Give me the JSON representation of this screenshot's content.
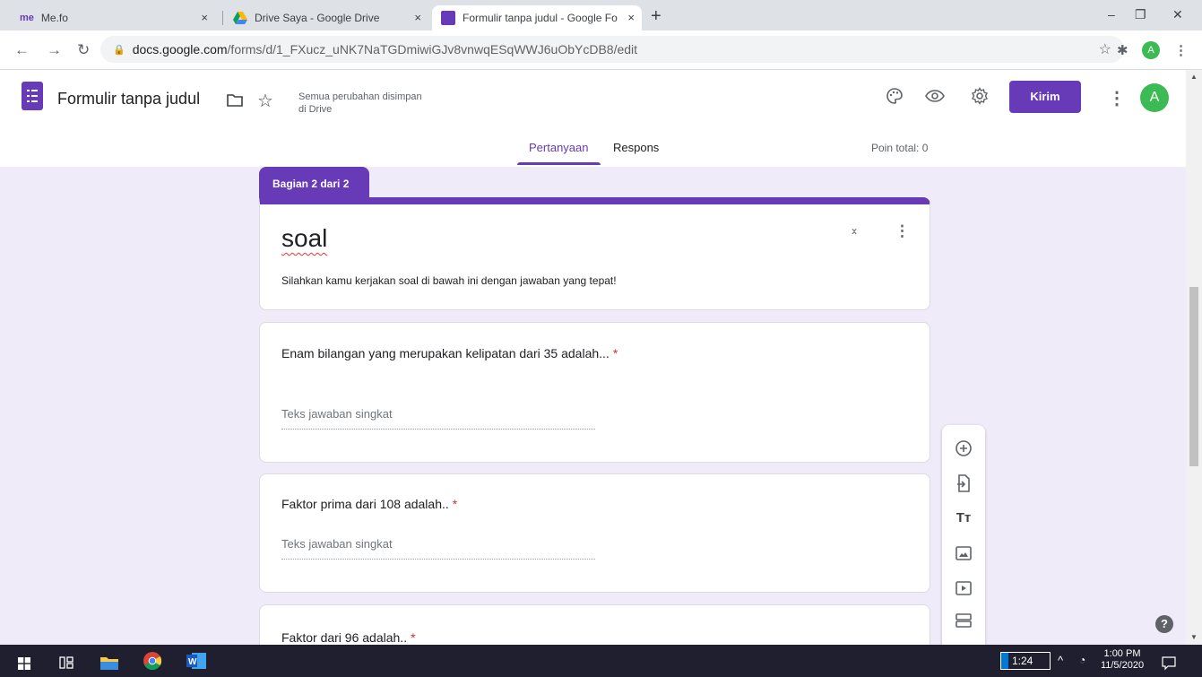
{
  "browser": {
    "tabs": [
      {
        "favicon_text": "me",
        "title": "Me.fo",
        "close": "×"
      },
      {
        "title": "Drive Saya - Google Drive",
        "close": "×"
      },
      {
        "title": "Formulir tanpa judul - Google Fo",
        "close": "×",
        "active": true
      }
    ],
    "new_tab": "+",
    "window_controls": {
      "minimize": "–",
      "restore": "❐",
      "close": "✕"
    },
    "url_domain": "docs.google.com",
    "url_path": "/forms/d/1_FXucz_uNK7NaTGDmiwiGJv8vnwqESqWWJ6uObYcDB8/edit",
    "profile_initial": "A"
  },
  "header": {
    "title": "Formulir tanpa judul",
    "save_status_line1": "Semua perubahan disimpan",
    "save_status_line2": "di Drive",
    "send_label": "Kirim",
    "avatar_initial": "A",
    "tabs": [
      "Pertanyaan",
      "Respons"
    ],
    "active_tab": "Pertanyaan",
    "points": "Poin total: 0"
  },
  "section": {
    "tag": "Bagian 2 dari 2",
    "title": "soal",
    "description": "Silahkan kamu kerjakan soal di bawah ini dengan jawaban yang tepat!"
  },
  "questions": [
    {
      "text": "Enam bilangan yang merupakan kelipatan dari 35 adalah...",
      "required": "*",
      "placeholder": "Teks jawaban singkat"
    },
    {
      "text": "Faktor prima dari 108 adalah..",
      "required": "*",
      "placeholder": "Teks jawaban singkat"
    },
    {
      "text": "Faktor dari 96 adalah..",
      "required": "*"
    }
  ],
  "toolbar_icons": [
    "add-question-icon",
    "import-questions-icon",
    "add-title-icon",
    "add-image-icon",
    "add-video-icon",
    "add-section-icon"
  ],
  "taskbar": {
    "lang_indicator": "1:24",
    "time": "1:00 PM",
    "date": "11/5/2020"
  },
  "colors": {
    "accent": "#673ab7",
    "background": "#efebf8",
    "required": "#d93025",
    "taskbar": "#1f1f2f"
  }
}
